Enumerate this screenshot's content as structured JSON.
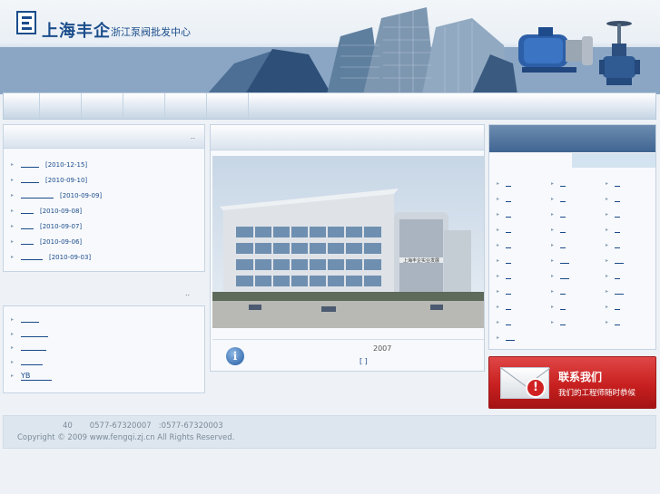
{
  "header": {
    "brand": "上海丰企",
    "slogan": "浙江泵阀批发中心"
  },
  "news": {
    "more": "..",
    "items": [
      {
        "date": "[2010-12-15]"
      },
      {
        "date": "[2010-09-10]"
      },
      {
        "date": "[2010-09-09]"
      },
      {
        "date": "[2010-09-08]"
      },
      {
        "date": "[2010-09-07]"
      },
      {
        "date": "[2010-09-06]"
      },
      {
        "date": "[2010-09-03]"
      }
    ]
  },
  "links": {
    "more": "..",
    "items": [
      {
        "label": ""
      },
      {
        "label": ""
      },
      {
        "label": ""
      },
      {
        "label": ""
      },
      {
        "label": "YB"
      }
    ]
  },
  "intro": {
    "year": "2007",
    "more": "[    ]"
  },
  "contact": {
    "title": "联系我们",
    "subtitle": "我们的工程师随时恭候"
  },
  "footer": {
    "line1": "40       0577-67320007   :0577-67320003",
    "line2": "Copyright © 2009 www.fengqi.zj.cn All Rights Reserved."
  },
  "colors": {
    "brand_blue": "#1b4d8c",
    "contact_red": "#c82020",
    "link_blue": "#1a4a8a"
  }
}
